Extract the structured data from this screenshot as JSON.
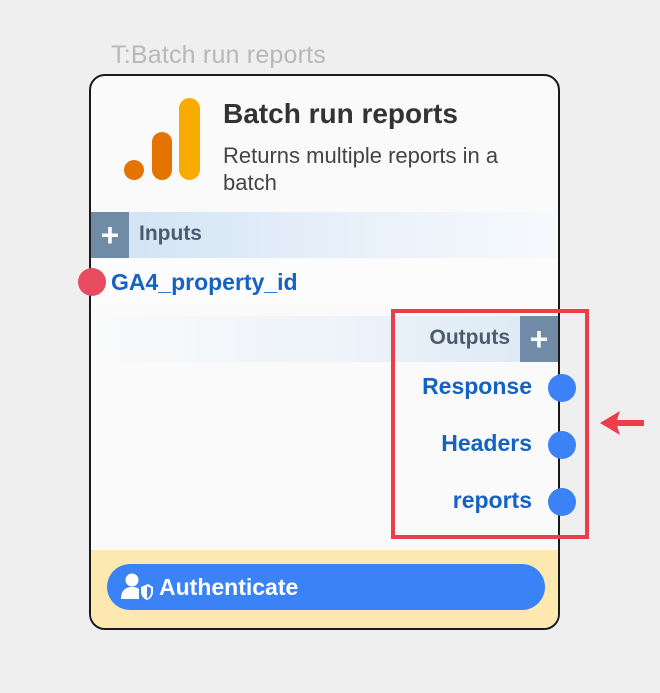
{
  "node": {
    "caption": "T:Batch run reports",
    "title": "Batch run reports",
    "subtitle": "Returns multiple reports in a batch",
    "logo_icon": "google-analytics-logo",
    "logo_colors": [
      "#e37400",
      "#f9ab00"
    ]
  },
  "inputs": {
    "label": "Inputs",
    "add_label": "+",
    "items": [
      {
        "label": "GA4_property_id",
        "port_color": "#e84a5f"
      }
    ]
  },
  "outputs": {
    "label": "Outputs",
    "add_label": "+",
    "items": [
      {
        "label": "Response",
        "port_color": "#3b82f6"
      },
      {
        "label": "Headers",
        "port_color": "#3b82f6"
      },
      {
        "label": "reports",
        "port_color": "#3b82f6"
      }
    ]
  },
  "footer": {
    "auth_label": "Authenticate",
    "auth_icon": "user-shield-icon",
    "background": "#fde8b0",
    "button_color": "#3b82f6"
  },
  "annotation": {
    "highlight_color": "#ec3d49",
    "arrow_icon": "arrow-left-icon"
  }
}
